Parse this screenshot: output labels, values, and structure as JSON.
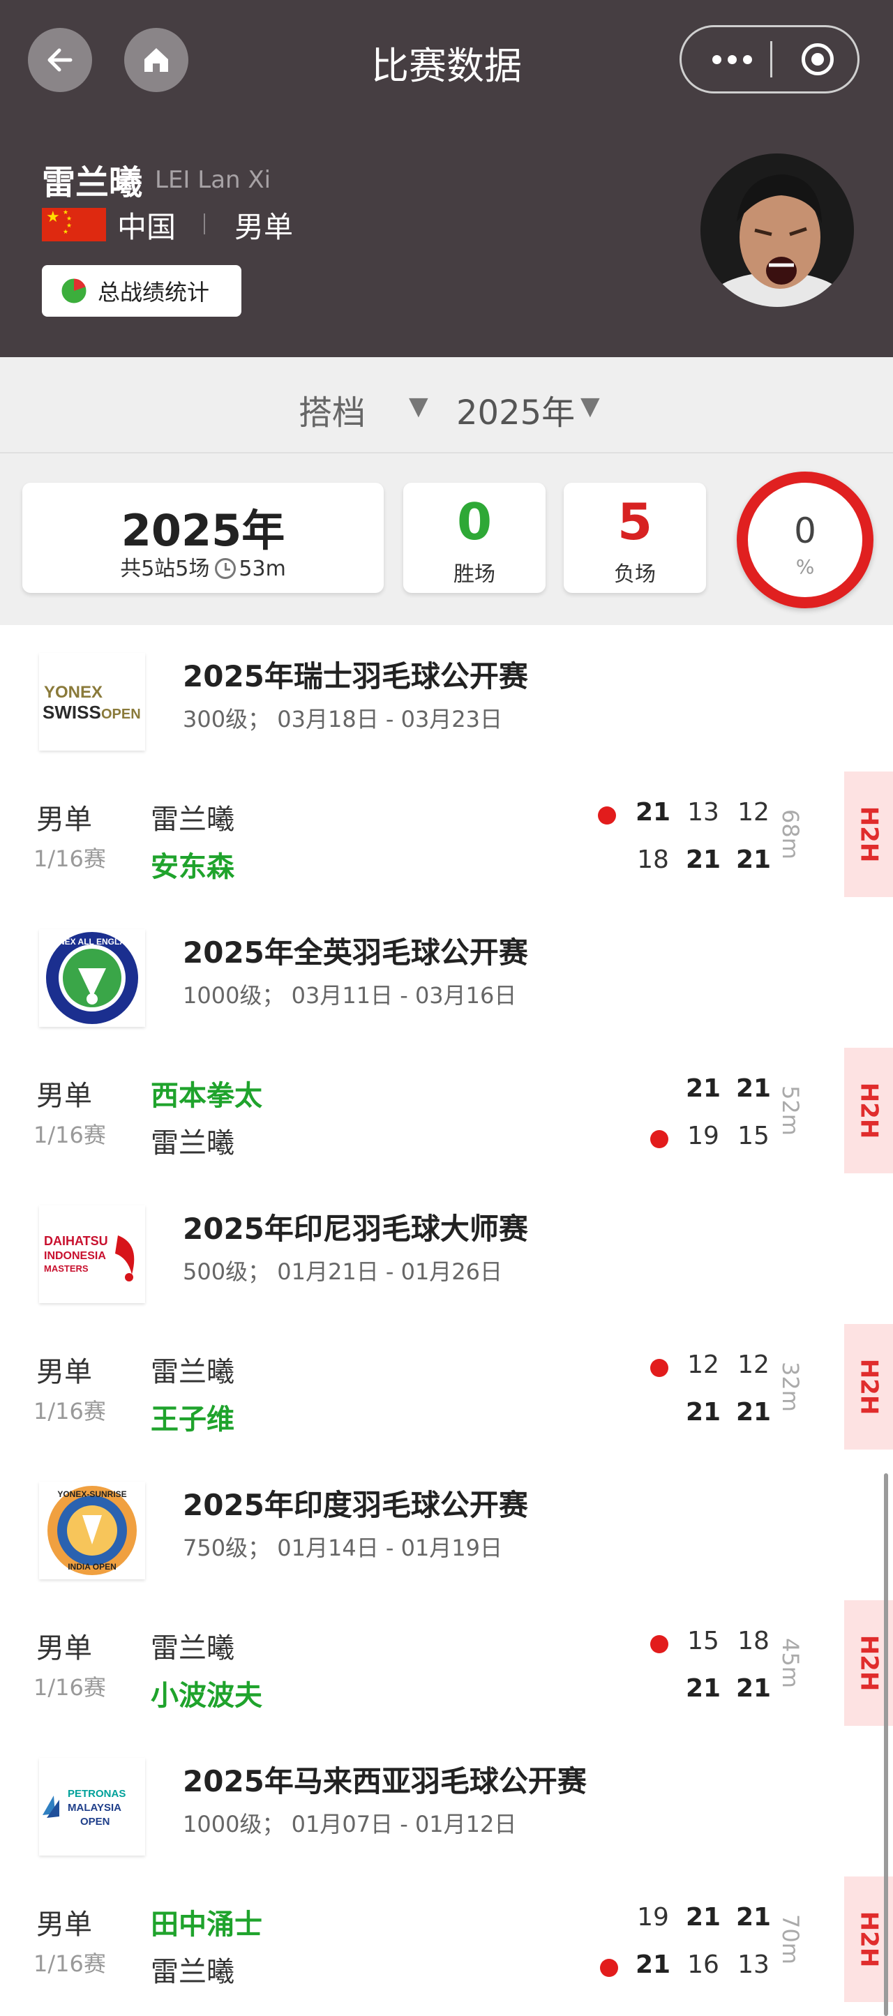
{
  "nav": {
    "title": "比赛数据"
  },
  "player": {
    "name_cn": "雷兰曦",
    "name_en": "LEI Lan Xi",
    "country": "中国",
    "event": "男单",
    "stats_button": "总战绩统计"
  },
  "filter": {
    "partner_label": "搭档",
    "year_label": "2025年"
  },
  "summary": {
    "year": "2025年",
    "stations_matches": "共5站5场",
    "total_time": "53m",
    "wins": "0",
    "wins_label": "胜场",
    "losses": "5",
    "losses_label": "负场",
    "win_rate": "0",
    "win_rate_unit": "%"
  },
  "colors": {
    "header_bg": "#463e42",
    "win_green": "#1fa32c",
    "loss_red": "#e02020",
    "h2h_bg": "#fde2e2"
  },
  "tournaments": [
    {
      "name": "2025年瑞士羽毛球公开赛",
      "info": "300级； 03月18日 - 03月23日",
      "logo": "yonex-swiss-open-logo",
      "match": {
        "event": "男单",
        "round": "1/16赛",
        "p1": "雷兰曦",
        "p2": "安东森",
        "p1_scores": [
          "21",
          "13",
          "12"
        ],
        "p2_scores": [
          "18",
          "21",
          "21"
        ],
        "duration": "68m",
        "h2h": "H2H"
      }
    },
    {
      "name": "2025年全英羽毛球公开赛",
      "info": "1000级； 03月11日 - 03月16日",
      "logo": "yonex-all-england-logo",
      "match": {
        "event": "男单",
        "round": "1/16赛",
        "p1": "西本拳太",
        "p2": "雷兰曦",
        "p1_scores": [
          "21",
          "21"
        ],
        "p2_scores": [
          "19",
          "15"
        ],
        "duration": "52m",
        "h2h": "H2H"
      }
    },
    {
      "name": "2025年印尼羽毛球大师赛",
      "info": "500级； 01月21日 - 01月26日",
      "logo": "daihatsu-indonesia-masters-logo",
      "match": {
        "event": "男单",
        "round": "1/16赛",
        "p1": "雷兰曦",
        "p2": "王子维",
        "p1_scores": [
          "12",
          "12"
        ],
        "p2_scores": [
          "21",
          "21"
        ],
        "duration": "32m",
        "h2h": "H2H"
      }
    },
    {
      "name": "2025年印度羽毛球公开赛",
      "info": "750级； 01月14日 - 01月19日",
      "logo": "yonex-sunrise-india-open-logo",
      "match": {
        "event": "男单",
        "round": "1/16赛",
        "p1": "雷兰曦",
        "p2": "小波波夫",
        "p1_scores": [
          "15",
          "18"
        ],
        "p2_scores": [
          "21",
          "21"
        ],
        "duration": "45m",
        "h2h": "H2H"
      }
    },
    {
      "name": "2025年马来西亚羽毛球公开赛",
      "info": "1000级； 01月07日 - 01月12日",
      "logo": "petronas-malaysia-open-logo",
      "match": {
        "event": "男单",
        "round": "1/16赛",
        "p1": "田中涌士",
        "p2": "雷兰曦",
        "p1_scores": [
          "19",
          "21",
          "21"
        ],
        "p2_scores": [
          "21",
          "16",
          "13"
        ],
        "duration": "70m",
        "h2h": "H2H"
      }
    }
  ]
}
